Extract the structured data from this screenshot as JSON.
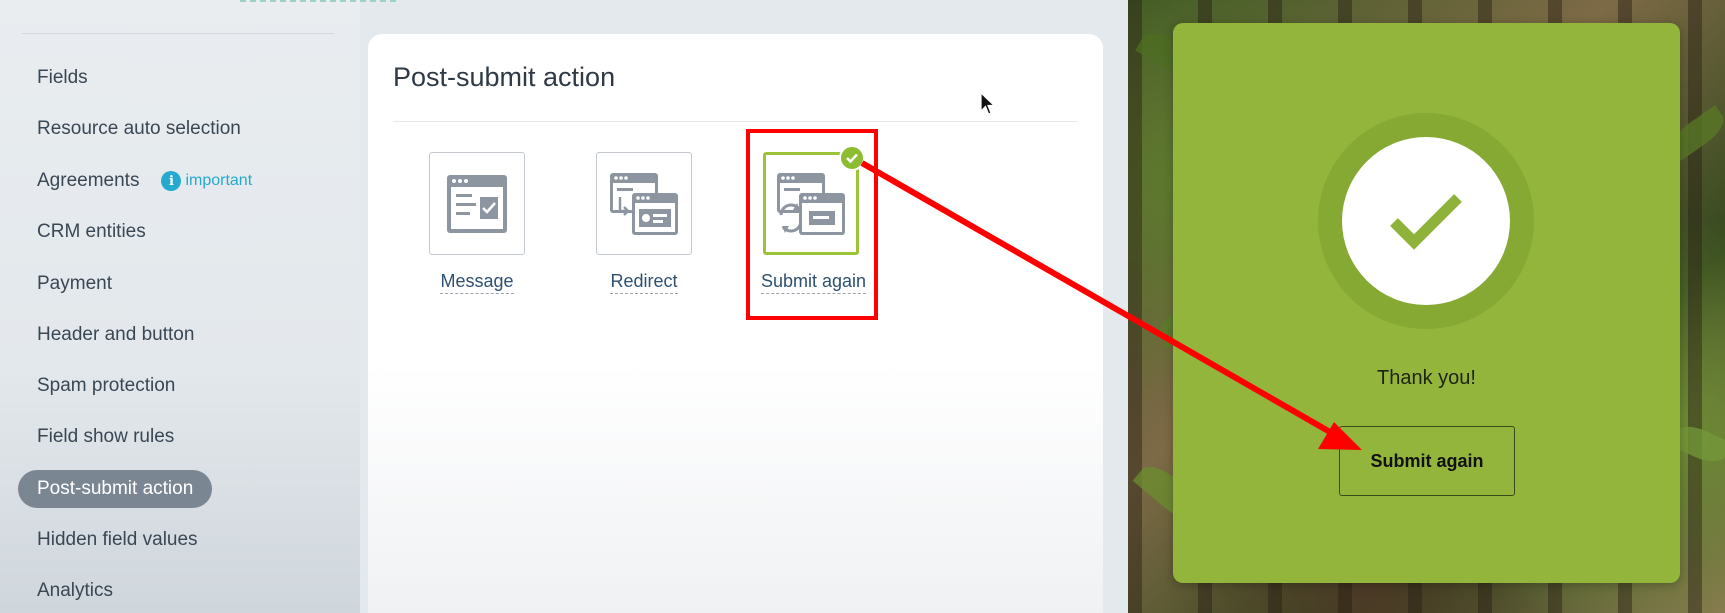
{
  "sidebar": {
    "items": [
      {
        "label": "Fields"
      },
      {
        "label": "Resource auto selection"
      },
      {
        "label": "Agreements",
        "badge": "important"
      },
      {
        "label": "CRM entities"
      },
      {
        "label": "Payment"
      },
      {
        "label": "Header and button"
      },
      {
        "label": "Spam protection"
      },
      {
        "label": "Field show rules"
      },
      {
        "label": "Post-submit action",
        "active": true
      },
      {
        "label": "Hidden field values"
      },
      {
        "label": "Analytics"
      }
    ]
  },
  "main": {
    "title": "Post-submit action",
    "options": [
      {
        "label": "Message",
        "icon": "message-window-icon"
      },
      {
        "label": "Redirect",
        "icon": "redirect-window-icon"
      },
      {
        "label": "Submit again",
        "icon": "submit-again-window-icon",
        "selected": true
      }
    ]
  },
  "preview": {
    "thank_you": "Thank you!",
    "button_label": "Submit again"
  },
  "colors": {
    "accent_green": "#93b53c",
    "selected_border": "#9cc43a",
    "annotation_red": "#ff0000",
    "active_nav": "#7b8693",
    "info_blue": "#26a9cf"
  }
}
